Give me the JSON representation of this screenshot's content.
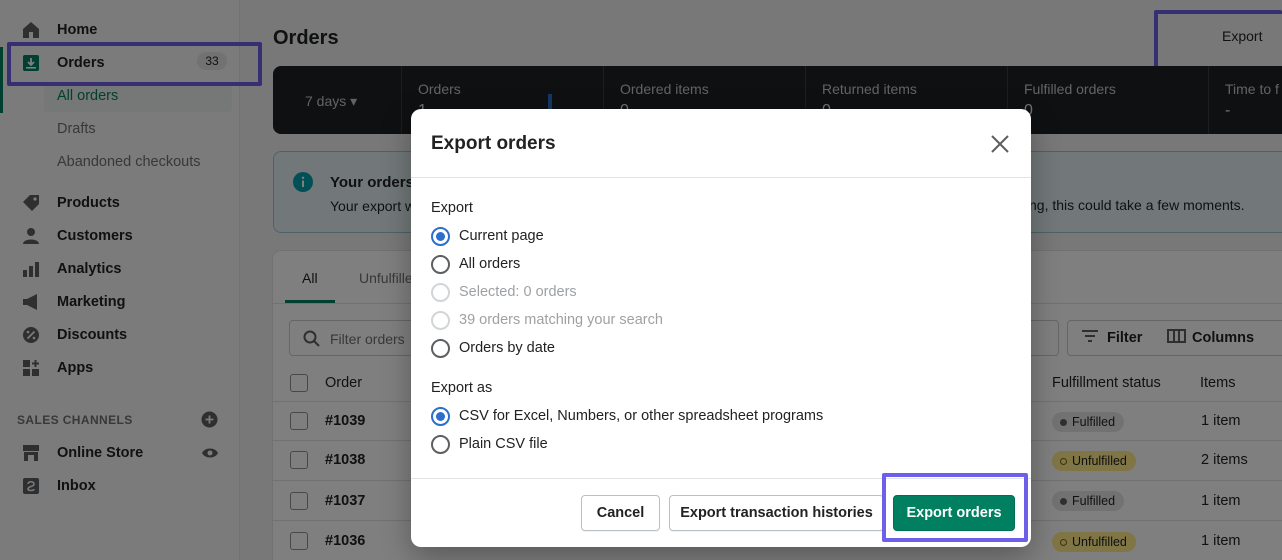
{
  "sidebar": {
    "home": "Home",
    "orders": "Orders",
    "orders_count": "33",
    "sub": {
      "all_orders": "All orders",
      "drafts": "Drafts",
      "abandoned": "Abandoned checkouts"
    },
    "products": "Products",
    "customers": "Customers",
    "analytics": "Analytics",
    "marketing": "Marketing",
    "discounts": "Discounts",
    "apps": "Apps",
    "sales_channels_label": "SALES CHANNELS",
    "online_store": "Online Store",
    "inbox": "Inbox"
  },
  "header": {
    "title": "Orders",
    "export": "Export"
  },
  "stats": {
    "range": "7 days",
    "items": [
      {
        "title": "Orders",
        "value": "1"
      },
      {
        "title": "Ordered items",
        "value": "0"
      },
      {
        "title": "Returned items",
        "value": "0"
      },
      {
        "title": "Fulfilled orders",
        "value": "0"
      },
      {
        "title": "Time to f",
        "value": "-"
      }
    ]
  },
  "banner": {
    "title": "Your orders",
    "text_left": "Your export w",
    "text_right": "ting, this could take a few moments."
  },
  "table": {
    "tabs": [
      "All",
      "Unfulfille"
    ],
    "filter_placeholder": "Filter orders",
    "filter_button": "Filter",
    "columns_button": "Columns",
    "headers": {
      "order": "Order",
      "fulfillment": "Fulfillment status",
      "items": "Items"
    },
    "rows": [
      {
        "order": "#1039",
        "status": "Fulfilled",
        "items": "1 item"
      },
      {
        "order": "#1038",
        "status": "Unfulfilled",
        "items": "2 items"
      },
      {
        "order": "#1037",
        "status": "Fulfilled",
        "items": "1 item"
      },
      {
        "order": "#1036",
        "status": "Unfulfilled",
        "items": "1 item"
      }
    ]
  },
  "modal": {
    "title": "Export orders",
    "export_label": "Export",
    "export_options": [
      "Current page",
      "All orders",
      "Selected: 0 orders",
      "39 orders matching your search",
      "Orders by date"
    ],
    "export_as_label": "Export as",
    "export_as_options": [
      "CSV for Excel, Numbers, or other spreadsheet programs",
      "Plain CSV file"
    ],
    "cancel": "Cancel",
    "export_transactions": "Export transaction histories",
    "export_orders": "Export orders"
  },
  "colors": {
    "accent_green": "#008060",
    "highlight": "#6d5fe8",
    "radio_blue": "#2c6ecb"
  }
}
